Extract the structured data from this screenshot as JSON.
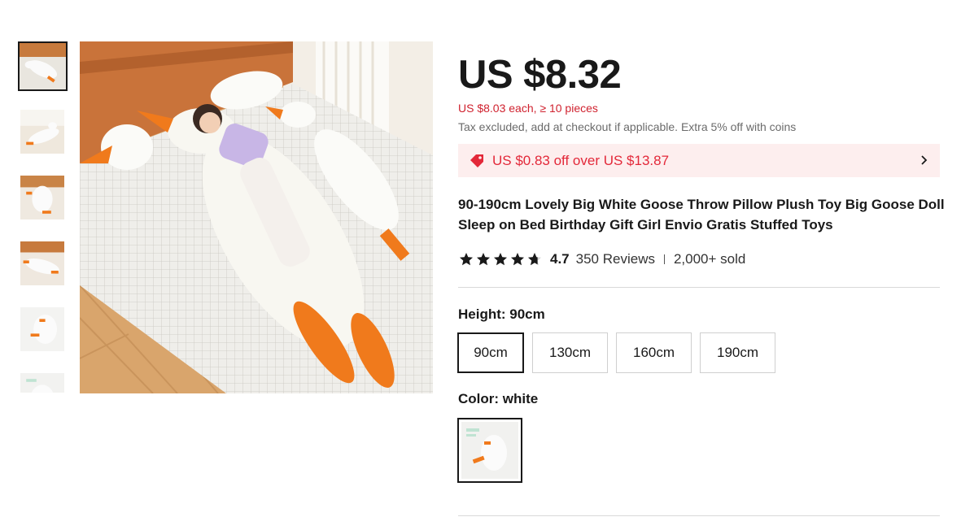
{
  "product": {
    "price": "US $8.32",
    "bulk_price": "US $8.03 each, ≥ 10 pieces",
    "tax_note": "Tax excluded, add at checkout if applicable. Extra 5% off with coins",
    "coupon": "US $0.83 off over US $13.87",
    "title": "90-190cm Lovely Big White Goose Throw Pillow Plush Toy Big Goose Doll Sleep on Bed Birthday Gift Girl Envio Gratis Stuffed Toys",
    "rating": "4.7",
    "rating_stars": 4.7,
    "reviews": "350 Reviews",
    "sold": "2,000+ sold"
  },
  "height": {
    "label": "Height: 90cm",
    "options": [
      "90cm",
      "130cm",
      "160cm",
      "190cm"
    ],
    "selected": "90cm"
  },
  "color": {
    "label": "Color: white",
    "selected": "white"
  },
  "gallery": {
    "thumbnail_count": 6,
    "selected_index": 0
  },
  "colors": {
    "accent_red": "#e32839",
    "coupon_bg": "#fdeeee",
    "text": "#191919",
    "muted": "#6b6b6b"
  },
  "icons": [
    "coupon-tag-icon",
    "chevron-right-icon",
    "star-icon"
  ]
}
